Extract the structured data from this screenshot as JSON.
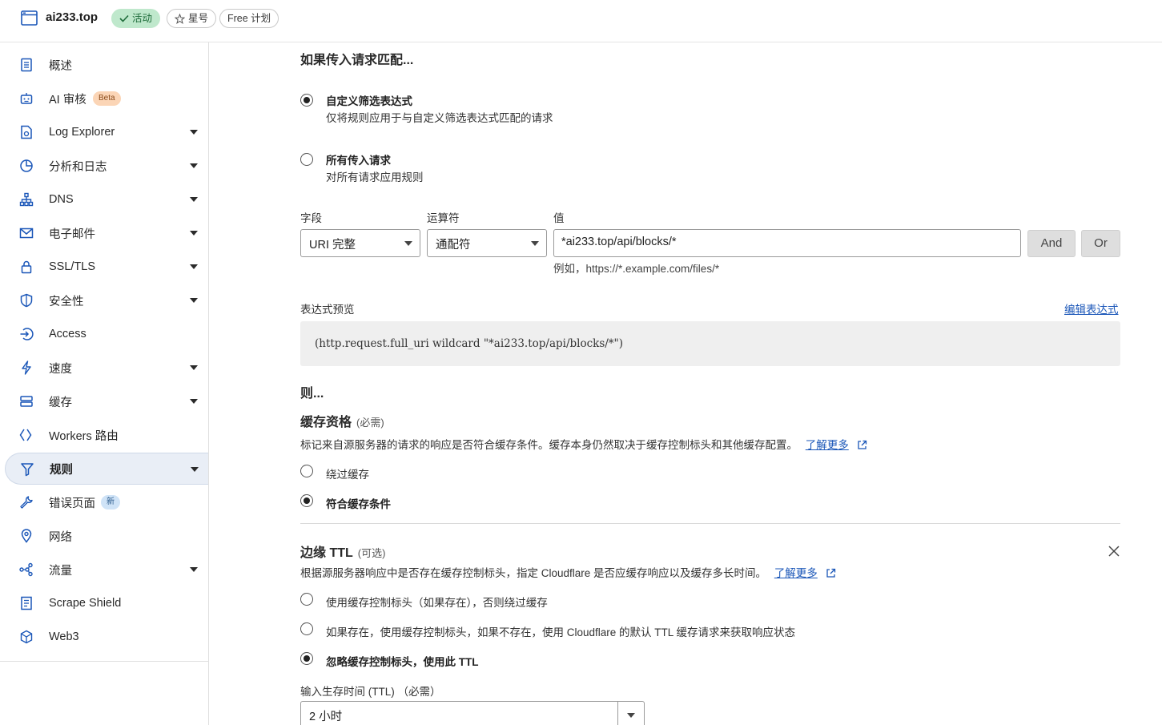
{
  "header": {
    "domain": "ai233.top",
    "status_badge": "活动",
    "star_label": "星号",
    "plan_label": "Free 计划"
  },
  "sidebar": {
    "items": [
      {
        "label": "概述"
      },
      {
        "label": "AI 审核",
        "badge": "Beta"
      },
      {
        "label": "Log Explorer"
      },
      {
        "label": "分析和日志"
      },
      {
        "label": "DNS"
      },
      {
        "label": "电子邮件"
      },
      {
        "label": "SSL/TLS"
      },
      {
        "label": "安全性"
      },
      {
        "label": "Access"
      },
      {
        "label": "速度"
      },
      {
        "label": "缓存"
      },
      {
        "label": "Workers 路由"
      },
      {
        "label": "规则"
      },
      {
        "label": "错误页面",
        "badge": "新"
      },
      {
        "label": "网络"
      },
      {
        "label": "流量"
      },
      {
        "label": "Scrape Shield"
      },
      {
        "label": "Web3"
      }
    ]
  },
  "match": {
    "title": "如果传入请求匹配...",
    "custom": {
      "title": "自定义筛选表达式",
      "desc": "仅将规则应用于与自定义筛选表达式匹配的请求",
      "selected": true
    },
    "all": {
      "title": "所有传入请求",
      "desc": "对所有请求应用规则",
      "selected": false
    },
    "field_label": "字段",
    "operator_label": "运算符",
    "value_label": "值",
    "field_value": "URI 完整",
    "operator_value": "通配符",
    "value_input": "*ai233.top/api/blocks/*",
    "and_label": "And",
    "or_label": "Or",
    "example": "例如，https://*.example.com/files/*",
    "preview_label": "表达式预览",
    "edit_expression": "编辑表达式",
    "expression": "(http.request.full_uri wildcard \"*ai233.top/api/blocks/*\")"
  },
  "then": {
    "title": "则..."
  },
  "cache_eligibility": {
    "title": "缓存资格",
    "required": "(必需)",
    "desc": "标记来自源服务器的请求的响应是否符合缓存条件。缓存本身仍然取决于缓存控制标头和其他缓存配置。",
    "learn_more": "了解更多",
    "bypass": "绕过缓存",
    "eligible": "符合缓存条件"
  },
  "edge_ttl": {
    "title": "边缘 TTL",
    "optional": "(可选)",
    "desc": "根据源服务器响应中是否存在缓存控制标头，指定 Cloudflare 是否应缓存响应以及缓存多长时间。",
    "learn_more": "了解更多",
    "opt1": "使用缓存控制标头（如果存在），否则绕过缓存",
    "opt2": "如果存在，使用缓存控制标头，如果不存在，使用 Cloudflare 的默认 TTL 缓存请求来获取响应状态",
    "opt3": "忽略缓存控制标头，使用此 TTL",
    "ttl_label": "输入生存时间 (TTL) （必需）",
    "ttl_value": "2 小时"
  }
}
